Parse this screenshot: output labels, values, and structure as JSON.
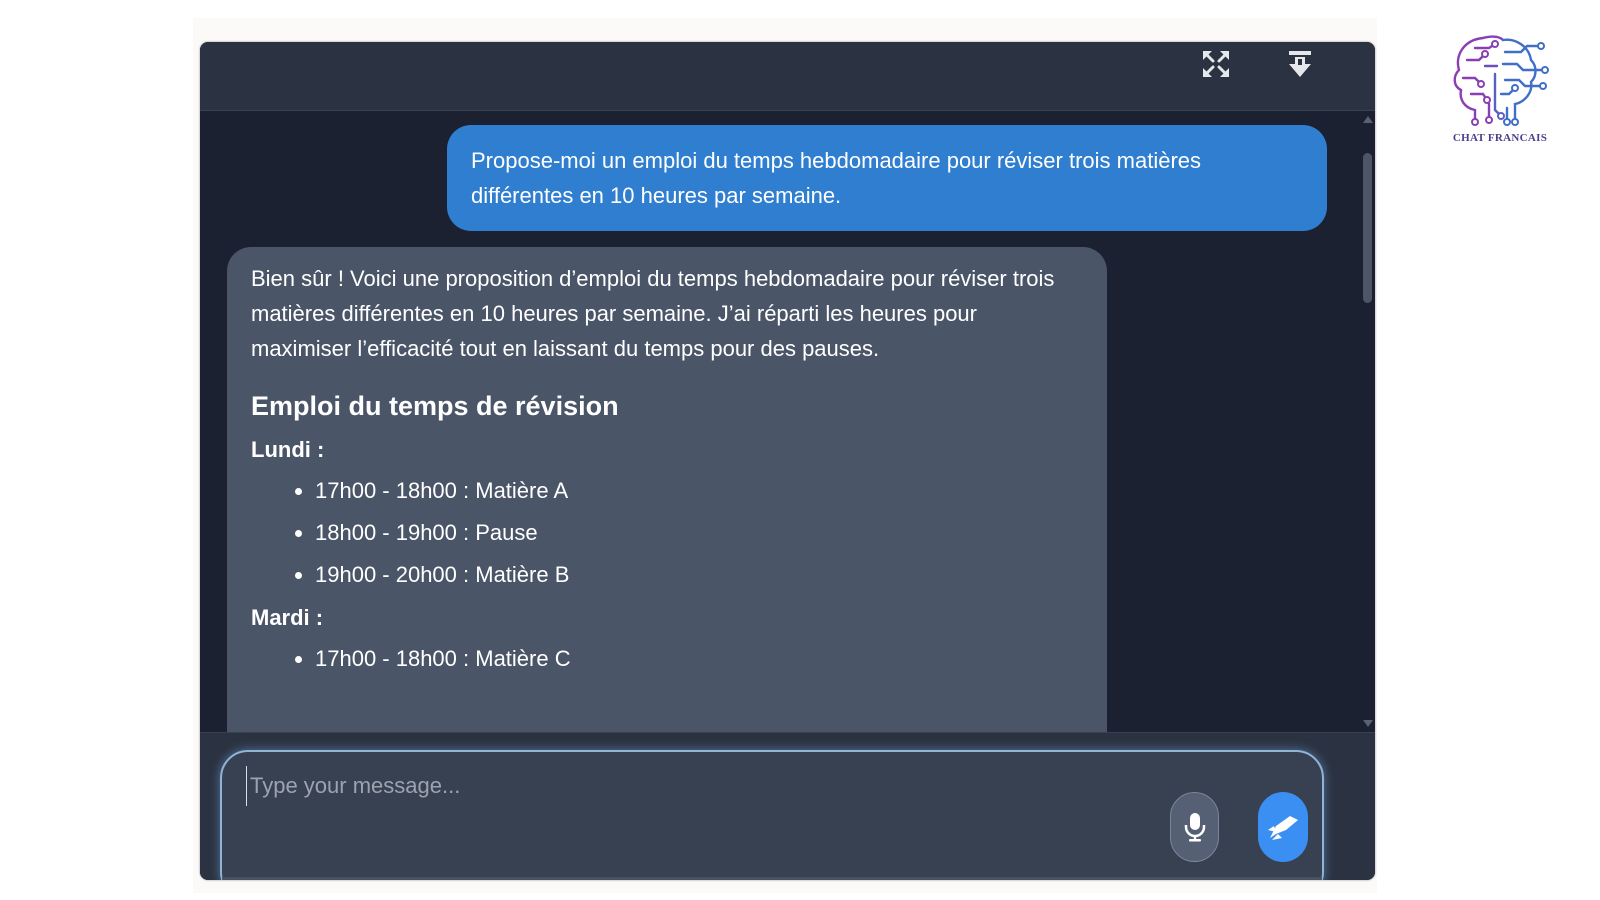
{
  "header": {
    "expand_icon": "expand-arrows-icon",
    "download_icon": "download-arrow-icon"
  },
  "conversation": {
    "user_message": "Propose-moi un emploi du temps hebdomadaire pour réviser trois matières différentes en 10 heures par semaine.",
    "bot_intro": "Bien sûr ! Voici une proposition d’emploi du temps hebdomadaire pour réviser trois matières différentes en 10 heures par semaine. J’ai réparti les heures pour maximiser l’efficacité tout en laissant du temps pour des pauses.",
    "bot_heading": "Emploi du temps de révision",
    "days": [
      {
        "label": "Lundi :",
        "items": [
          "17h00 - 18h00 : Matière A",
          "18h00 - 19h00 : Pause",
          "19h00 - 20h00 : Matière B"
        ]
      },
      {
        "label": "Mardi :",
        "items": [
          "17h00 - 18h00 : Matière C"
        ]
      }
    ]
  },
  "composer": {
    "placeholder": "Type your message...",
    "mic_icon": "microphone-icon",
    "send_icon": "send-icon"
  },
  "logo": {
    "caption": "CHAT FRANCAIS",
    "icon": "circuit-head-icon"
  },
  "colors": {
    "window_bg": "#1b2130",
    "header_bg": "#2b3342",
    "user_bubble": "#2f7ed0",
    "bot_bubble": "#4b5568",
    "send_button": "#3b8ef2",
    "logo_purple": "#8a3fb5",
    "logo_blue": "#3f6fc8"
  }
}
